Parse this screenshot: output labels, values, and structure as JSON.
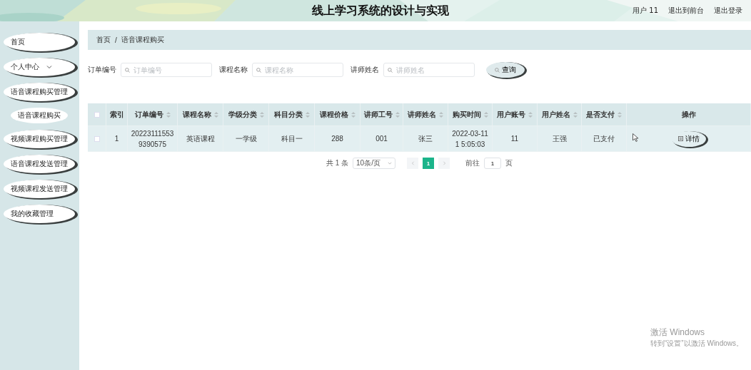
{
  "header": {
    "title": "线上学习系统的设计与实现",
    "links": [
      "用户 11",
      "退出到前台",
      "退出登录"
    ]
  },
  "sidebar": {
    "items": [
      {
        "label": "首页",
        "kind": "item"
      },
      {
        "label": "个人中心",
        "kind": "dropdown"
      },
      {
        "label": "语音课程购买管理",
        "kind": "item"
      },
      {
        "label": "语音课程购买",
        "kind": "subitem"
      },
      {
        "label": "视频课程购买管理",
        "kind": "item"
      },
      {
        "label": "语音课程发送管理",
        "kind": "item"
      },
      {
        "label": "视频课程发送管理",
        "kind": "item"
      },
      {
        "label": "我的收藏管理",
        "kind": "item"
      }
    ]
  },
  "breadcrumb": {
    "items": [
      "首页",
      "语音课程购买"
    ],
    "separator": "/"
  },
  "search": {
    "fields": [
      {
        "label": "订单编号",
        "placeholder": "订单编号"
      },
      {
        "label": "课程名称",
        "placeholder": "课程名称"
      },
      {
        "label": "讲师姓名",
        "placeholder": "讲师姓名"
      }
    ],
    "button": "查询"
  },
  "table": {
    "all_checked": false,
    "columns": [
      {
        "label": "索引",
        "sortable": false
      },
      {
        "label": "订单编号",
        "sortable": true
      },
      {
        "label": "课程名称",
        "sortable": true
      },
      {
        "label": "学级分类",
        "sortable": true
      },
      {
        "label": "科目分类",
        "sortable": true
      },
      {
        "label": "课程价格",
        "sortable": true
      },
      {
        "label": "讲师工号",
        "sortable": true
      },
      {
        "label": "讲师姓名",
        "sortable": true
      },
      {
        "label": "购买时间",
        "sortable": true
      },
      {
        "label": "用户账号",
        "sortable": true
      },
      {
        "label": "用户姓名",
        "sortable": true
      },
      {
        "label": "是否支付",
        "sortable": true
      },
      {
        "label": "操作",
        "sortable": false
      }
    ],
    "rows": [
      {
        "checked": false,
        "cells": [
          "1",
          "20223111553 9390575",
          "英语课程",
          "一学级",
          "科目一",
          "288",
          "001",
          "张三",
          "2022-03-11 1 5:05:03",
          "11",
          "王强",
          "已支付"
        ],
        "action": "详情"
      }
    ]
  },
  "pagination": {
    "total": "共 1 条",
    "page_size": "10条/页",
    "pages": [
      {
        "label": "1",
        "selected": true
      }
    ],
    "goto_label": "前往",
    "goto_value": "1",
    "goto_suffix": "页"
  },
  "os_notice": {
    "title": "激活 Windows",
    "text": "转到“设置”以激活 Windows。"
  }
}
